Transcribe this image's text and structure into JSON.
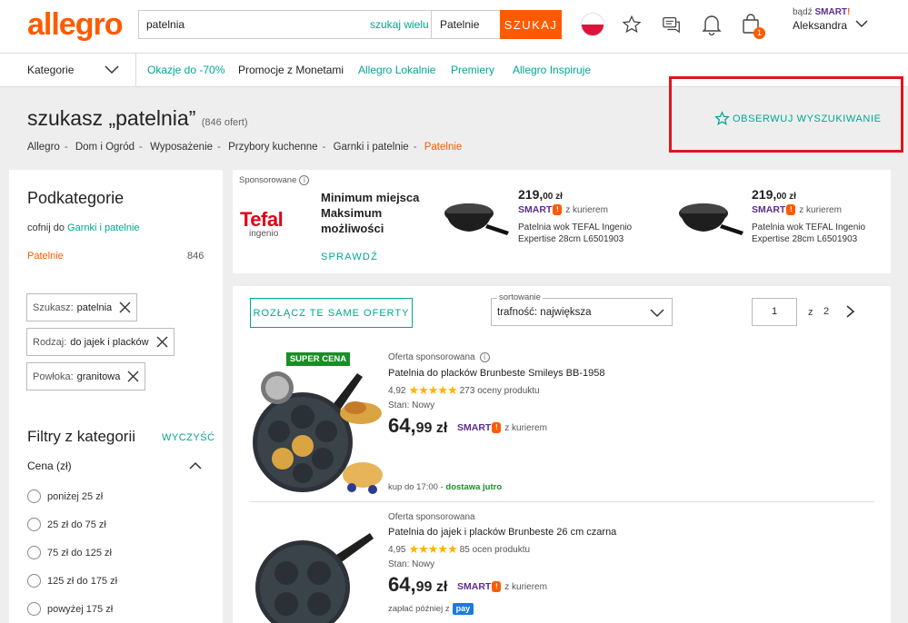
{
  "header": {
    "logo": "allegro",
    "search_value": "patelnia",
    "search_many": "szukaj wielu",
    "category": "Patelnie",
    "search_button": "SZUKAJ",
    "cart_count": "1",
    "smart_prefix": "bądź",
    "smart_label": "SMART",
    "user_name": "Aleksandra"
  },
  "nav": {
    "categories": "Kategorie",
    "links": [
      "Okazje do -70%",
      "Promocje z Monetami",
      "Allegro Lokalnie",
      "Premiery",
      "Allegro Inspiruje"
    ]
  },
  "title": {
    "text": "szukasz „patelnia”",
    "count": "(846 ofert)",
    "observe": "OBSERWUJ WYSZUKIWANIE"
  },
  "breadcrumb": [
    "Allegro",
    "Dom i Ogród",
    "Wyposażenie",
    "Przybory kuchenne",
    "Garnki i patelnie",
    "Patelnie"
  ],
  "sidebar": {
    "subcategories_heading": "Podkategorie",
    "back_prefix": "cofnij do",
    "back_link": "Garnki i patelnie",
    "subcategory": "Patelnie",
    "subcategory_count": "846",
    "chips": [
      {
        "label": "Szukasz:",
        "value": "patelnia"
      },
      {
        "label": "Rodzaj:",
        "value": "do jajek i placków"
      },
      {
        "label": "Powłoka:",
        "value": "granitowa"
      }
    ],
    "filters_heading": "Filtry z kategorii",
    "clear": "WYCZYŚĆ",
    "price_heading": "Cena (zł)",
    "price_options": [
      "poniżej 25 zł",
      "25 zł do 75 zł",
      "75 zł do 125 zł",
      "125 zł do 175 zł",
      "powyżej 175 zł"
    ]
  },
  "banner": {
    "tag": "Sponsorowane",
    "brand": "Tefal",
    "brand_sub": "ingenio",
    "tagline": "Minimum miejsca Maksimum możliwości",
    "cta": "SPRAWDŹ",
    "products": [
      {
        "price_int": "219,",
        "price_dec": "00 zł",
        "smart": "SMART",
        "courier": "z kurierem",
        "name": "Patelnia wok TEFAL Ingenio Expertise 28cm L6501903"
      },
      {
        "price_int": "219,",
        "price_dec": "00 zł",
        "smart": "SMART",
        "courier": "z kurierem",
        "name": "Patelnia wok TEFAL Ingenio Expertise 28cm L6501903"
      }
    ]
  },
  "listing": {
    "disconnect": "ROZŁĄCZ TE SAME OFERTY",
    "sort_label": "sortowanie",
    "sort_value": "trafność: największa",
    "page_current": "1",
    "page_of": "z",
    "page_total": "2",
    "offers": [
      {
        "badge": "SUPER CENA",
        "sponsored": "Oferta sponsorowana",
        "title": "Patelnia do placków Brunbeste Smileys BB-1958",
        "rating": "4,92",
        "stars": "★★★★★",
        "reviews": "273 oceny produktu",
        "condition": "Stan: Nowy",
        "price_int": "64,",
        "price_dec": "99 zł",
        "smart": "SMART",
        "courier": "z kurierem",
        "delivery_prefix": "kup do 17:00 -",
        "delivery": "dostawa jutro"
      },
      {
        "sponsored": "Oferta sponsorowana",
        "title": "Patelnia do jajek i placków Brunbeste 26 cm czarna",
        "rating": "4,95",
        "stars": "★★★★★",
        "reviews": "85 ocen produktu",
        "condition": "Stan: Nowy",
        "price_int": "64,",
        "price_dec": "99 zł",
        "smart": "SMART",
        "courier": "z kurierem",
        "pay_later": "zapłać później z",
        "pay_badge": "pay"
      }
    ]
  }
}
